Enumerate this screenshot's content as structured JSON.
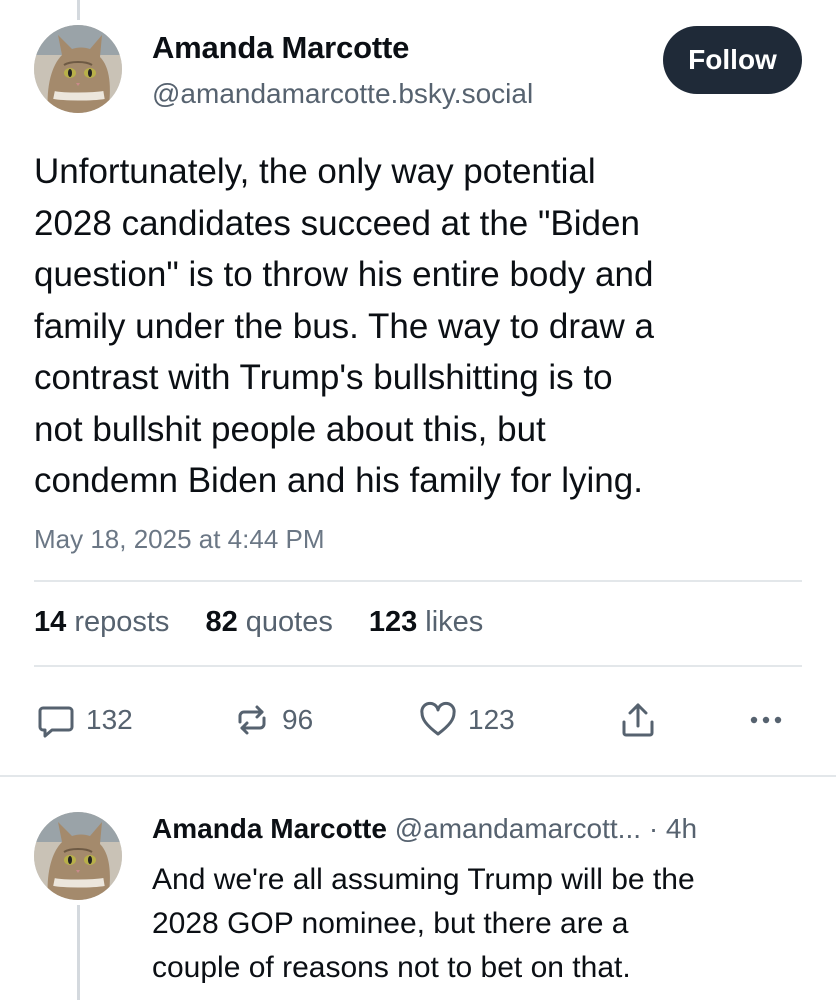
{
  "post": {
    "author_name": "Amanda Marcotte",
    "author_handle": "@amandamarcotte.bsky.social",
    "follow_label": "Follow",
    "text_lines": [
      "Unfortunately, the only way potential",
      "2028 candidates succeed at the \"Biden",
      "question\" is to throw his entire body and",
      "family under the bus. The way to draw a",
      "contrast with Trump's bullshitting is to",
      "not bullshit people about this, but",
      "condemn Biden and his family for lying."
    ],
    "timestamp": "May 18, 2025 at 4:44 PM",
    "stats": {
      "reposts_count": "14",
      "reposts_label": "reposts",
      "quotes_count": "82",
      "quotes_label": "quotes",
      "likes_count": "123",
      "likes_label": "likes"
    },
    "actions": {
      "reply_count": "132",
      "repost_count": "96",
      "like_count": "123",
      "reply_icon": "speech-bubble-icon",
      "repost_icon": "repost-arrows-icon",
      "like_icon": "heart-icon",
      "share_icon": "share-icon",
      "more_icon": "ellipsis-icon"
    }
  },
  "reply": {
    "author_name": "Amanda Marcotte",
    "author_handle": "@amandamarcott...",
    "time": "· 4h",
    "text_lines": [
      "And we're all assuming Trump will be the",
      "2028 GOP nominee, but there are a",
      "couple of reasons not to bet on that."
    ]
  },
  "colors": {
    "follow_bg": "#1f2a38",
    "muted_text": "#56626f",
    "divider": "#e3e7ea"
  }
}
